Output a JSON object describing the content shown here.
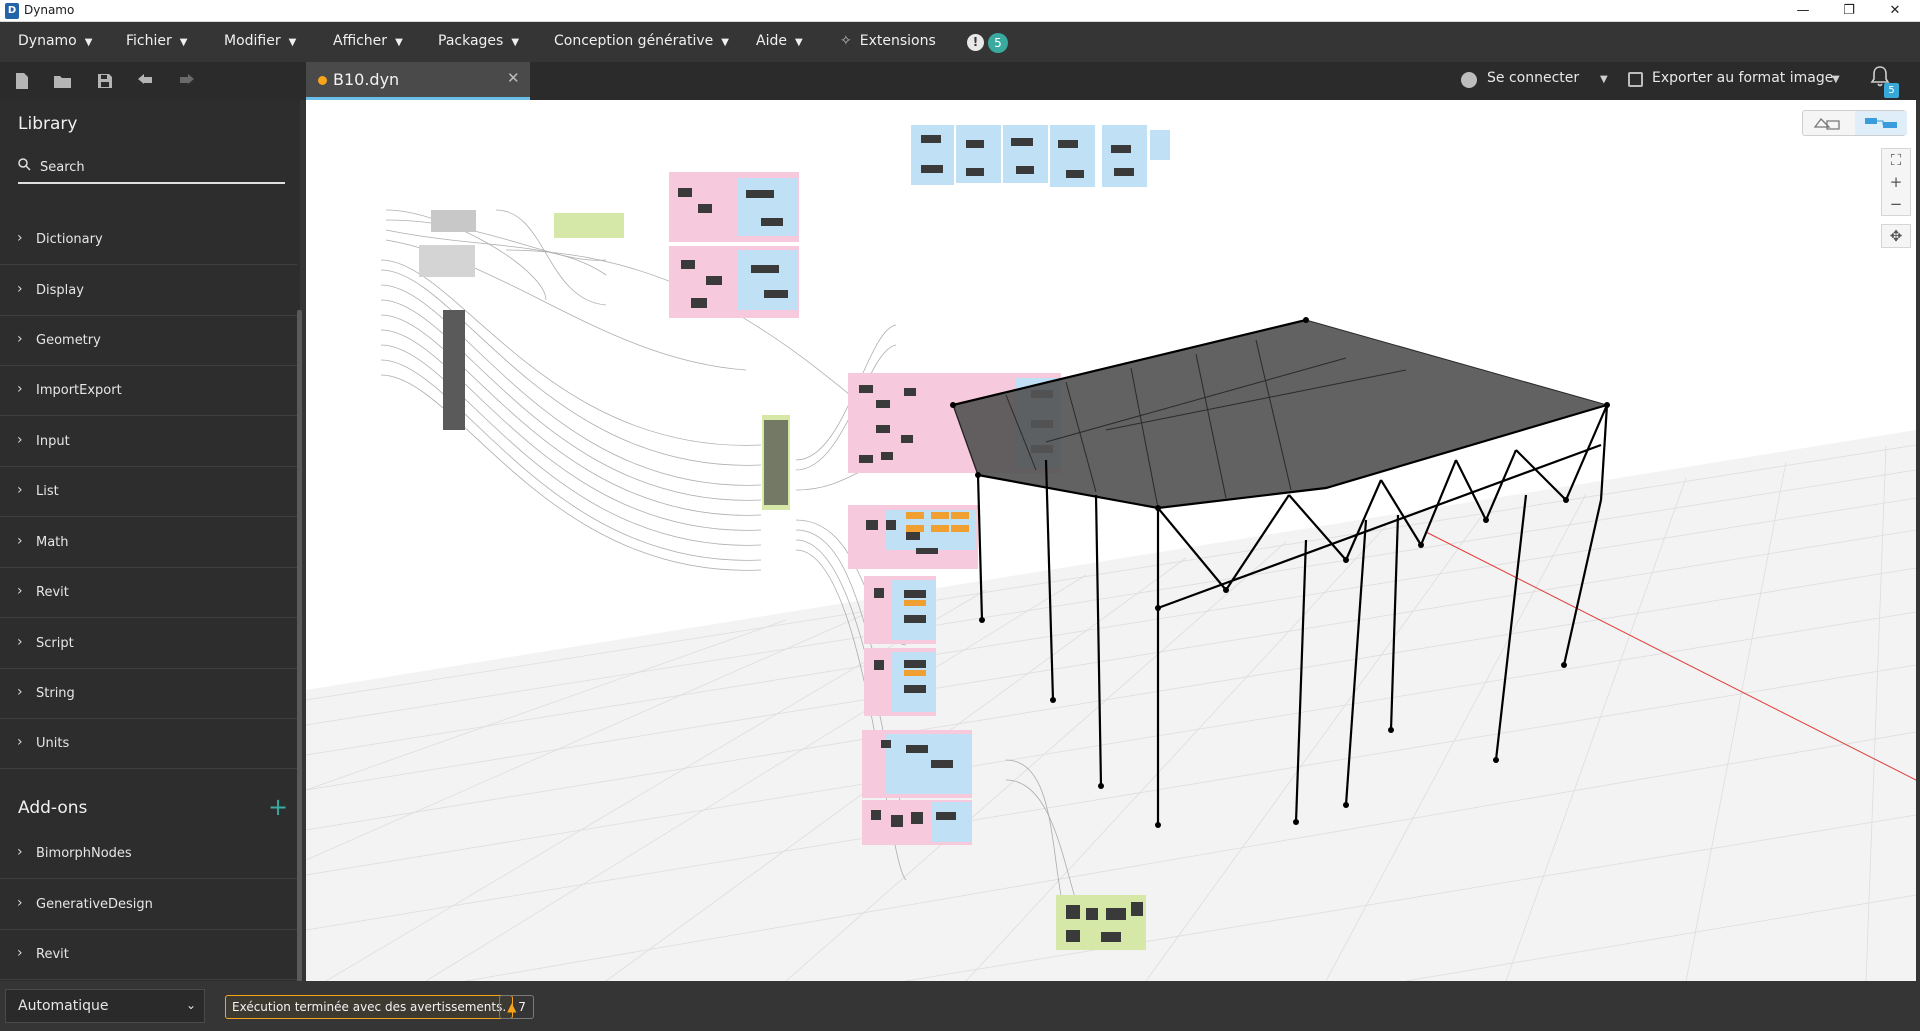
{
  "window": {
    "title": "Dynamo",
    "minimize": "—",
    "maximize": "❐",
    "close": "✕"
  },
  "menu": {
    "items": [
      {
        "label": "Dynamo"
      },
      {
        "label": "Fichier"
      },
      {
        "label": "Modifier"
      },
      {
        "label": "Afficher"
      },
      {
        "label": "Packages"
      },
      {
        "label": "Conception générative"
      },
      {
        "label": "Aide"
      }
    ],
    "extensions_label": "Extensions",
    "notifications_count": "5"
  },
  "tab": {
    "label": "B10.dyn",
    "close": "✕"
  },
  "toolbar": {
    "signin_label": "Se connecter",
    "export_label": "Exporter au format image",
    "bell_badge": "5"
  },
  "library": {
    "title": "Library",
    "search_placeholder": "Search",
    "items": [
      {
        "label": "Dictionary"
      },
      {
        "label": "Display"
      },
      {
        "label": "Geometry"
      },
      {
        "label": "ImportExport"
      },
      {
        "label": "Input"
      },
      {
        "label": "List"
      },
      {
        "label": "Math"
      },
      {
        "label": "Revit"
      },
      {
        "label": "Script"
      },
      {
        "label": "String"
      },
      {
        "label": "Units"
      }
    ],
    "addons_title": "Add-ons",
    "addons": [
      {
        "label": "BimorphNodes"
      },
      {
        "label": "GenerativeDesign"
      },
      {
        "label": "Revit"
      }
    ]
  },
  "status": {
    "run_mode": "Automatique",
    "message": "Exécution terminée avec des avertissements.",
    "warning_count": "7"
  },
  "colors": {
    "accent_teal": "#3aa99f",
    "warning_orange": "#f7a31c",
    "tab_underline": "#6ac0e8",
    "group_pink": "#f7c9dd",
    "group_blue": "#bfe0f5",
    "group_green": "#d6e8a8",
    "axis_red": "#e23b3b"
  }
}
